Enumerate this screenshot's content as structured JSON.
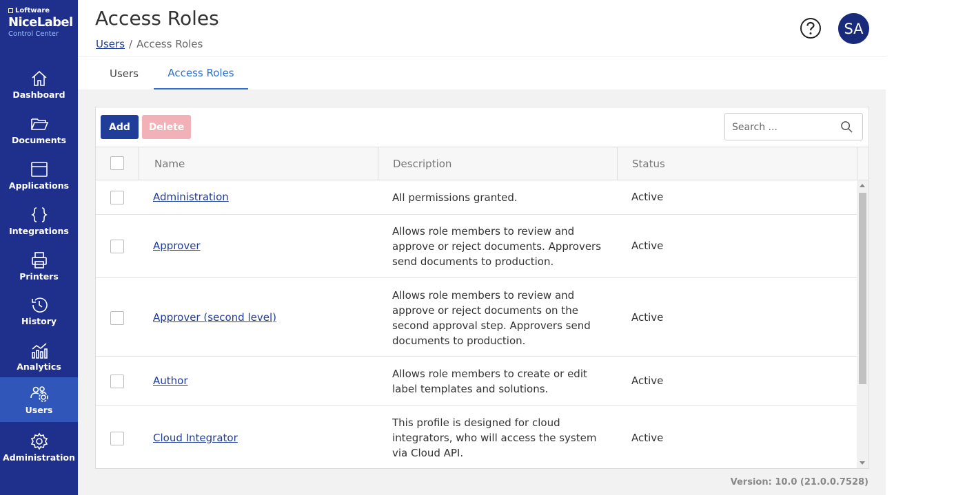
{
  "logo": {
    "vendor": "Loftware",
    "product": "NiceLabel",
    "subtitle": "Control Center"
  },
  "sidebar": {
    "items": [
      {
        "label": "Dashboard",
        "icon": "home-icon"
      },
      {
        "label": "Documents",
        "icon": "folder-icon"
      },
      {
        "label": "Applications",
        "icon": "window-icon"
      },
      {
        "label": "Integrations",
        "icon": "braces-icon"
      },
      {
        "label": "Printers",
        "icon": "printer-icon"
      },
      {
        "label": "History",
        "icon": "history-icon"
      },
      {
        "label": "Analytics",
        "icon": "analytics-icon"
      },
      {
        "label": "Users",
        "icon": "users-gear-icon",
        "active": true
      },
      {
        "label": "Administration",
        "icon": "gear-icon"
      }
    ]
  },
  "header": {
    "title": "Access Roles",
    "breadcrumb": {
      "link": "Users",
      "separator": "/",
      "current": "Access Roles"
    },
    "avatar_initials": "SA"
  },
  "tabs": [
    {
      "label": "Users",
      "active": false
    },
    {
      "label": "Access Roles",
      "active": true
    }
  ],
  "toolbar": {
    "add_label": "Add",
    "delete_label": "Delete",
    "search_placeholder": "Search ..."
  },
  "table": {
    "columns": [
      "Name",
      "Description",
      "Status"
    ],
    "rows": [
      {
        "name": "Administration",
        "description": "All permissions granted.",
        "status": "Active"
      },
      {
        "name": "Approver",
        "description": "Allows role members to review and approve or reject documents. Approvers send documents to production.",
        "status": "Active"
      },
      {
        "name": "Approver (second level)",
        "description": "Allows role members to review and approve or reject documents on the second approval step. Approvers send documents to production.",
        "status": "Active"
      },
      {
        "name": "Author",
        "description": "Allows role members to create or edit label templates and solutions.",
        "status": "Active"
      },
      {
        "name": "Cloud Integrator",
        "description": "This profile is designed for cloud integrators, who will access the system via Cloud API.",
        "status": "Active"
      }
    ]
  },
  "footer": {
    "version": "Version: 10.0 (21.0.0.7528)"
  },
  "colors": {
    "sidebar": "#1f2f8c",
    "sidebar_active": "#2f56b8",
    "accent": "#2a6fd6",
    "primary_button": "#1f3d99",
    "delete_button_disabled": "#f1b1b6"
  }
}
